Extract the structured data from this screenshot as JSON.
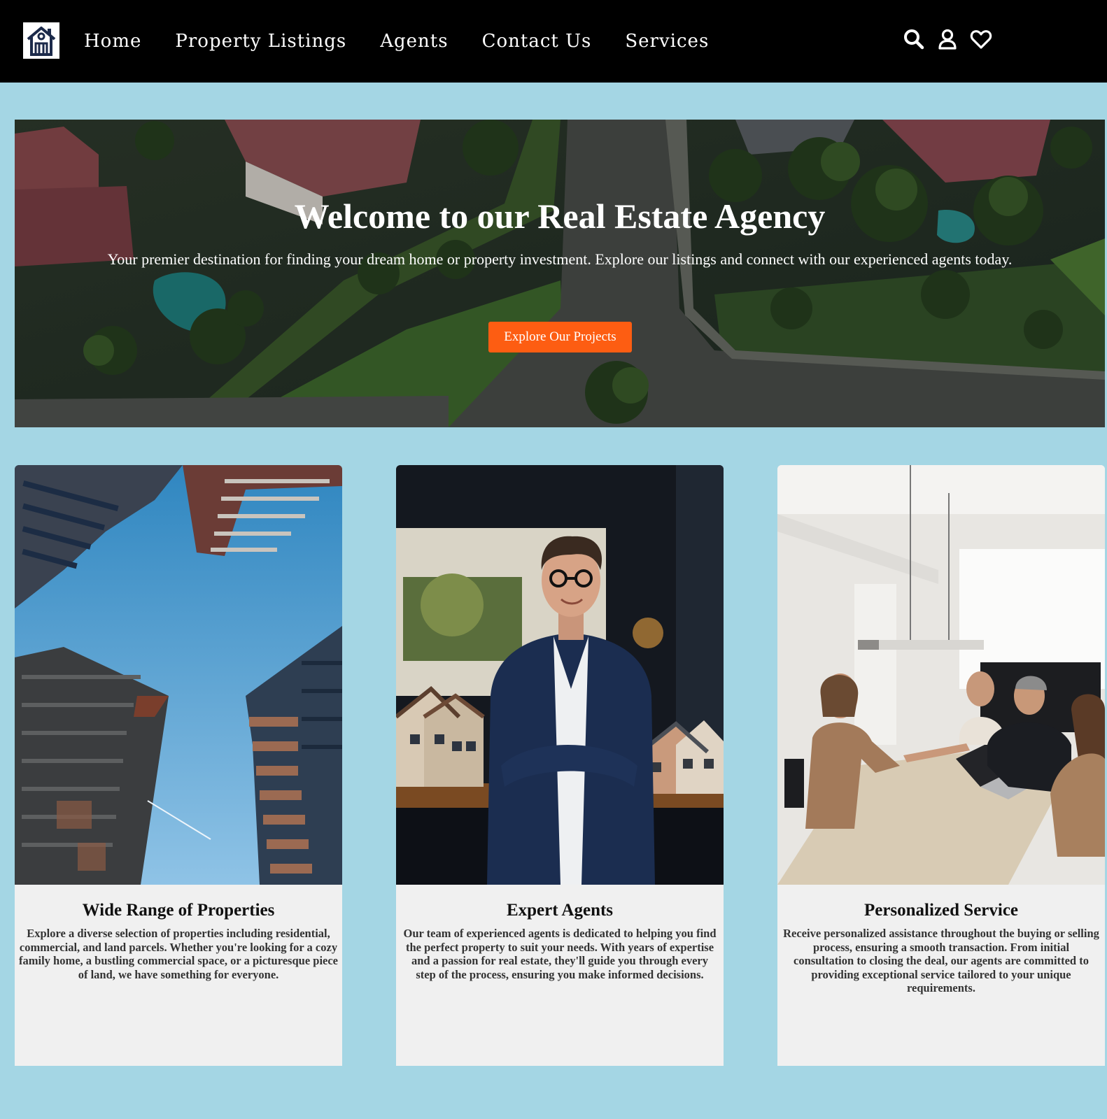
{
  "nav": {
    "logo": "house-logo-icon",
    "links": [
      "Home",
      "Property Listings",
      "Agents",
      "Contact Us",
      "Services"
    ],
    "icons": [
      "search-icon",
      "user-icon",
      "heart-icon"
    ]
  },
  "hero": {
    "title": "Welcome to our Real Estate Agency",
    "subtitle": "Your premier destination for finding your dream home or property investment. Explore our listings and connect with our experienced agents today.",
    "cta_label": "Explore Our Projects"
  },
  "features": [
    {
      "title": "Wide Range of Properties",
      "text": "Explore a diverse selection of properties including residential, commercial, and land parcels. Whether you're looking for a cozy family home, a bustling commercial space, or a picturesque piece of land, we have something for everyone."
    },
    {
      "title": "Expert Agents",
      "text": "Our team of experienced agents is dedicated to helping you find the perfect property to suit your needs. With years of expertise and a passion for real estate, they'll guide you through every step of the process, ensuring you make informed decisions."
    },
    {
      "title": "Personalized Service",
      "text": "Receive personalized assistance throughout the buying or selling process, ensuring a smooth transaction. From initial consultation to closing the deal, our agents are committed to providing exceptional service tailored to your unique requirements."
    }
  ],
  "colors": {
    "page_bg": "#a4d6e4",
    "nav_bg": "#000000",
    "cta": "#fd5d12",
    "card_bg": "#f0f0f0"
  }
}
